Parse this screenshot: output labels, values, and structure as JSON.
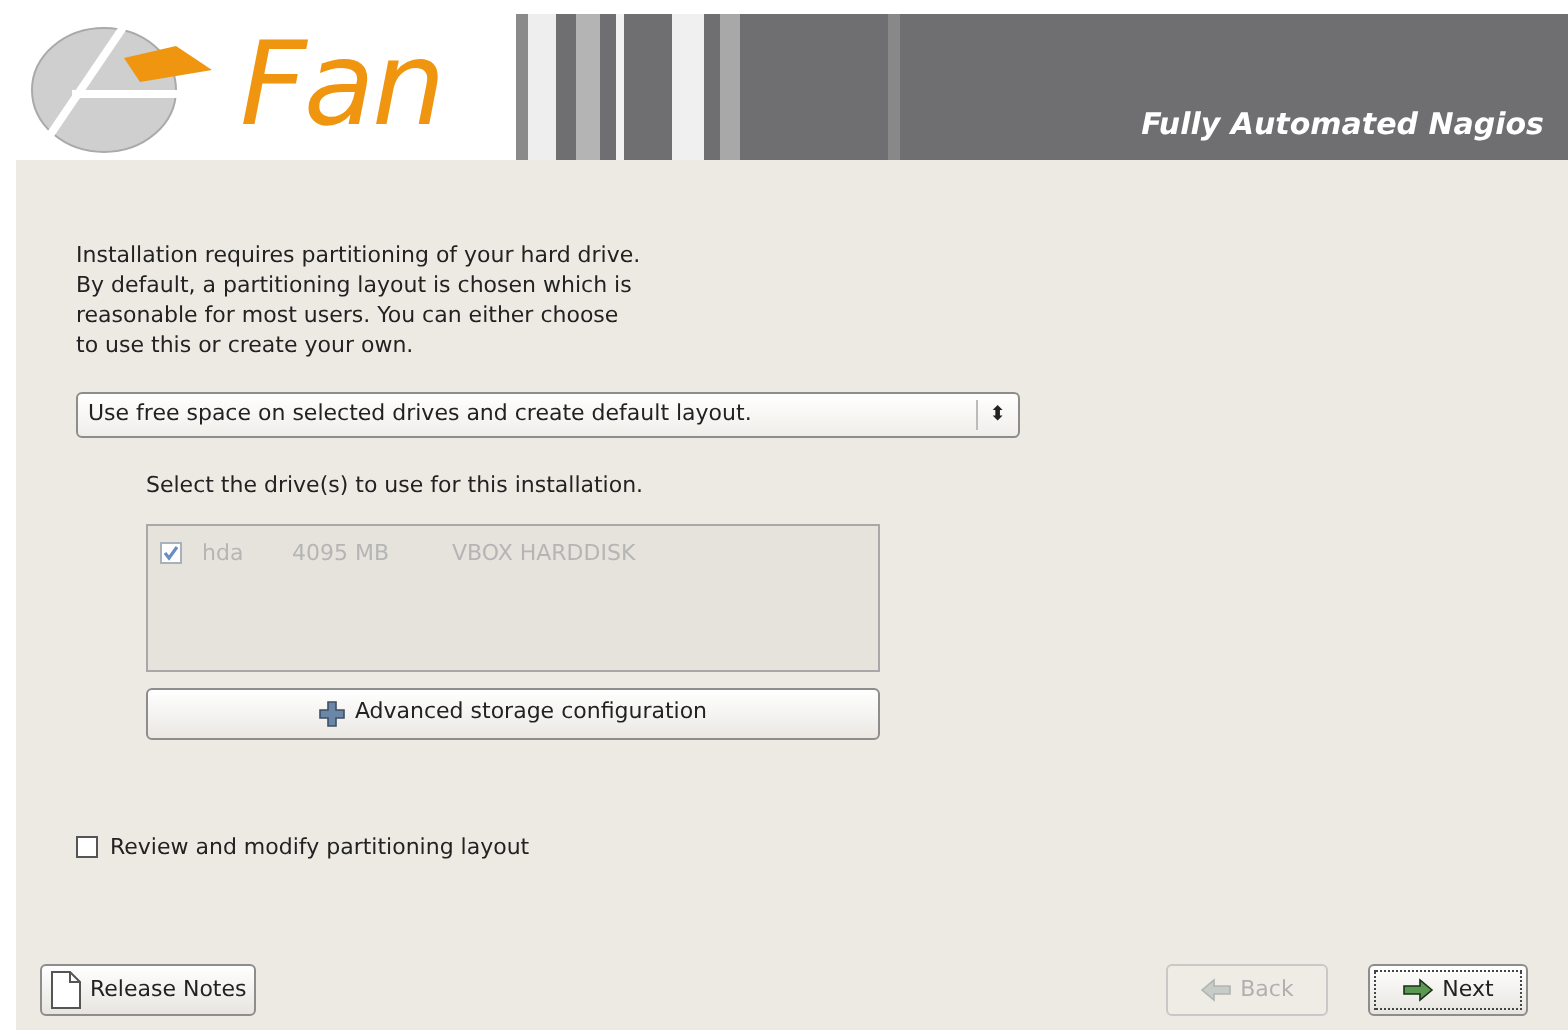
{
  "header": {
    "logo_text": "Fan",
    "tagline": "Fully Automated Nagios"
  },
  "intro": "Installation requires partitioning of your hard drive.\nBy default, a partitioning layout is chosen which is\nreasonable for most users.  You can either choose\nto use this or create your own.",
  "layout_select": {
    "value": "Use free space on selected drives and create default layout.",
    "arrow": "⬍"
  },
  "drives_label": "Select the drive(s) to use for this installation.",
  "drives": [
    {
      "checked": true,
      "disabled": true,
      "name": "hda",
      "size": "4095 MB",
      "model": "VBOX HARDDISK"
    }
  ],
  "advanced_button": "Advanced storage configuration",
  "review_checkbox": {
    "label": "Review and modify partitioning layout",
    "checked": false
  },
  "buttons": [
    {
      "kind": "release",
      "label": "Release Notes",
      "disabled": false
    },
    {
      "kind": "back",
      "label": "Back",
      "disabled": true
    },
    {
      "kind": "next",
      "label": "Next",
      "disabled": false
    }
  ]
}
